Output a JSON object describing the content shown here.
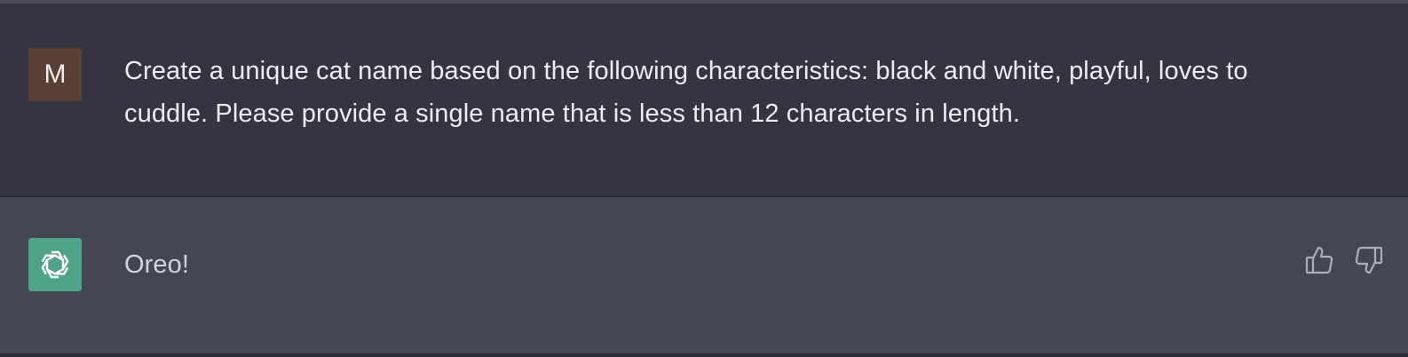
{
  "conversation": {
    "user_message": {
      "avatar_initial": "M",
      "text": "Create a unique cat name based on the following characteristics: black and white, playful, loves to cuddle. Please provide a single name that is less than 12 characters in length."
    },
    "assistant_message": {
      "avatar_icon": "openai-logo-icon",
      "text": "Oreo!"
    }
  },
  "feedback": {
    "thumbs_up_icon": "thumbs-up-icon",
    "thumbs_down_icon": "thumbs-down-icon"
  },
  "colors": {
    "user_background": "#343541",
    "assistant_background": "#444654",
    "user_avatar": "#5a3f34",
    "assistant_avatar": "#4fa386",
    "text": "#ececf1"
  }
}
